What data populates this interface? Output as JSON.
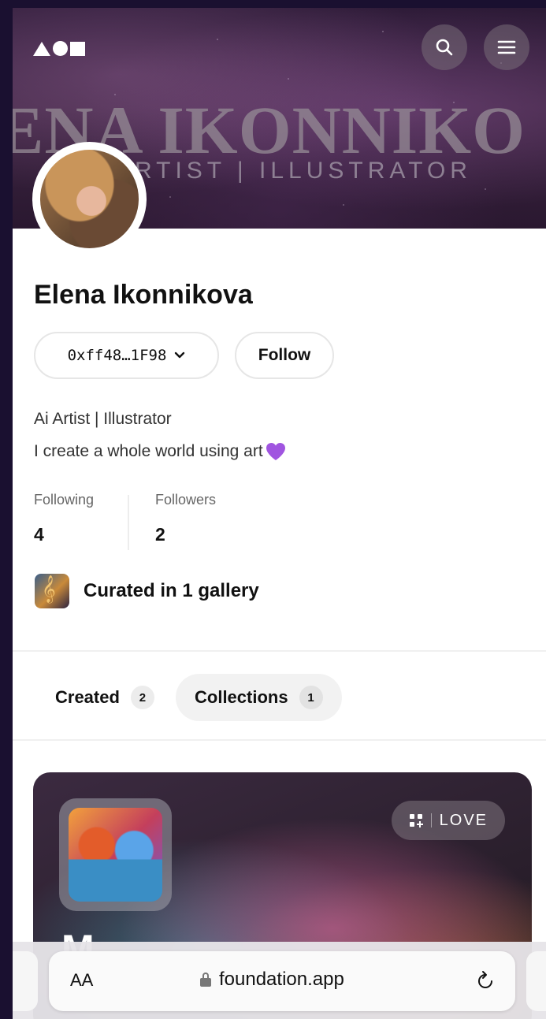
{
  "banner": {
    "big_text": "ENA IKONNIKO",
    "sub_text": "RTIST | ILLUSTRATOR"
  },
  "header": {
    "logo": "foundation-logo",
    "search_icon": "search-icon",
    "menu_icon": "menu-icon"
  },
  "profile": {
    "name": "Elena Ikonnikova",
    "address": "0xff48…1F98",
    "follow_label": "Follow",
    "bio_line1": "Ai Artist | Illustrator",
    "bio_line2": "I create a whole world using art",
    "following_label": "Following",
    "following_count": "4",
    "followers_label": "Followers",
    "followers_count": "2",
    "gallery_text": "Curated in 1 gallery"
  },
  "tabs": [
    {
      "label": "Created",
      "count": "2"
    },
    {
      "label": "Collections",
      "count": "1"
    }
  ],
  "card": {
    "badge_label": "LOVE",
    "title_peek": "M"
  },
  "browser": {
    "text_size_label": "AA",
    "url": "foundation.app"
  },
  "colors": {
    "accent_heart": "#a055e0",
    "background": "#1a1030",
    "text_primary": "#111111"
  }
}
